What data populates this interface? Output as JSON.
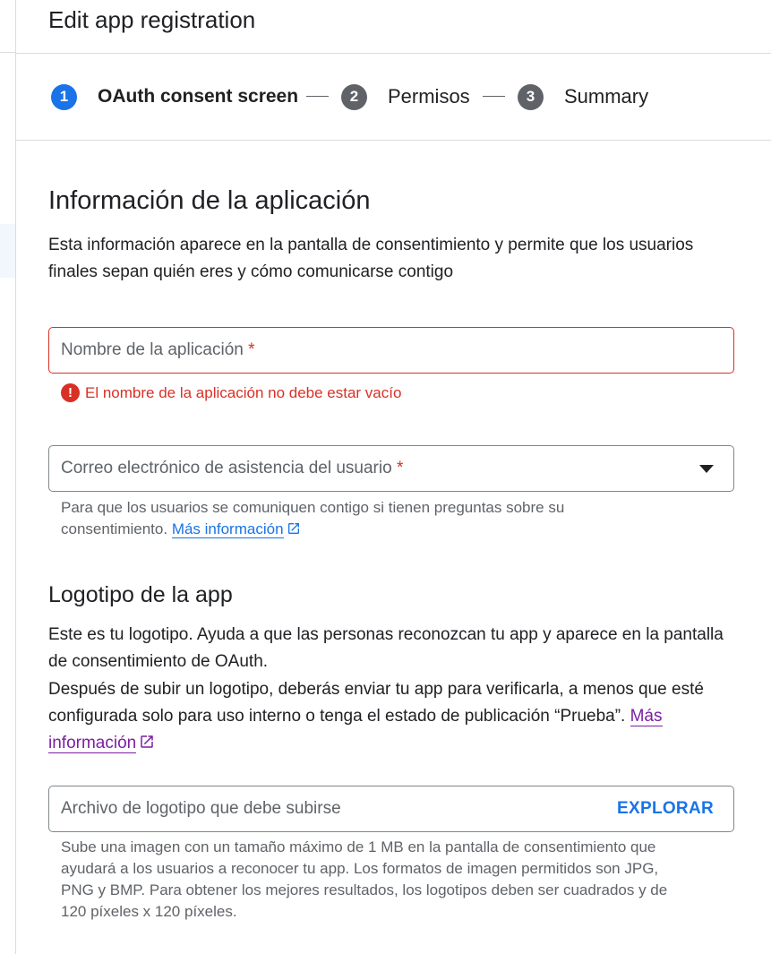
{
  "header": {
    "title": "Edit app registration"
  },
  "stepper": {
    "steps": [
      {
        "number": "1",
        "label": "OAuth consent screen"
      },
      {
        "number": "2",
        "label": "Permisos"
      },
      {
        "number": "3",
        "label": "Summary"
      }
    ]
  },
  "app_info": {
    "heading": "Información de la aplicación",
    "description_line1": "Esta información aparece en la pantalla de consentimiento y permite que los usuarios",
    "description_line2": "finales sepan quién eres y cómo comunicarse contigo",
    "app_name_field": {
      "placeholder": "Nombre de la aplicación",
      "required_mark": "*",
      "error": "El nombre de la aplicación no debe estar vacío"
    },
    "support_email_field": {
      "placeholder": "Correo electrónico de asistencia del usuario",
      "required_mark": "*",
      "hint_line1": "Para que los usuarios se comuniquen contigo si tienen preguntas sobre su",
      "hint_line2": "consentimiento.",
      "hint_link": "Más información"
    }
  },
  "logo": {
    "heading": "Logotipo de la app",
    "para_line1": "Este es tu logotipo. Ayuda a que las personas reconozcan tu app y aparece en la pantalla",
    "para_line2": "de consentimiento de OAuth.",
    "para_line3": "Después de subir un logotipo, deberás enviar tu app para verificarla, a menos que esté",
    "para_line4": "configurada solo para uso interno o tenga el estado de publicación “Prueba”.",
    "link_part1": "Más",
    "link_part2": "información",
    "file_field": {
      "placeholder": "Archivo de logotipo que debe subirse",
      "browse_label": "EXPLORAR"
    },
    "hint_line1": "Sube una imagen con un tamaño máximo de 1 MB en la pantalla de consentimiento que",
    "hint_line2": "ayudará a los usuarios a reconocer tu app. Los formatos de imagen permitidos son JPG,",
    "hint_line3": "PNG y BMP. Para obtener los mejores resultados, los logotipos deben ser cuadrados y de",
    "hint_line4": "120 píxeles x 120 píxeles."
  },
  "colors": {
    "accent": "#1a73e8",
    "error": "#d93025",
    "visited_link": "#7b1fa2",
    "step_inactive": "#5f6368"
  },
  "icons": {
    "error": "error-circle-icon",
    "external_link": "open-in-new-icon",
    "dropdown": "arrow-drop-down-icon"
  }
}
